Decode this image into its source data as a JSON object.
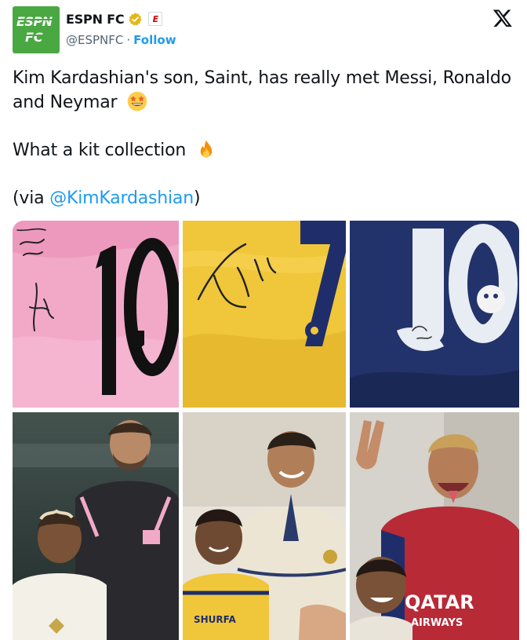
{
  "account": {
    "display_name": "ESPN FC",
    "handle": "@ESPNFC",
    "separator": "·",
    "follow_label": "Follow",
    "avatar_text_line1": "ESPN",
    "avatar_text_line2": "FC",
    "affiliate_badge": "E",
    "brand_color": "#4aa843",
    "verified_color": "#e2b719"
  },
  "tweet": {
    "line1": "Kim Kardashian's son, Saint, has really met Messi, Ronaldo and Neymar",
    "emoji1": "star-struck-emoji",
    "line2": "What a kit collection",
    "emoji2": "fire-emoji",
    "via_prefix": "(via ",
    "via_mention": "@KimKardashian",
    "via_suffix": ")"
  },
  "media": {
    "tiles": [
      {
        "name": "messi-signed-jersey",
        "text": "10",
        "color": "#f2a9c8"
      },
      {
        "name": "ronaldo-signed-jersey",
        "text": "7",
        "color": "#f0c63a"
      },
      {
        "name": "neymar-signed-jersey",
        "text": "10",
        "color": "#22336b"
      },
      {
        "name": "saint-with-messi-photo",
        "color": "#2b3b3a"
      },
      {
        "name": "saint-with-ronaldo-photo",
        "sponsor": "SHURFA",
        "color": "#e8e4da"
      },
      {
        "name": "saint-with-neymar-photo",
        "sponsor": "QATAR",
        "sponsor2": "AIRWAYS",
        "color": "#b72a36"
      }
    ]
  },
  "colors": {
    "link": "#1d9bf0",
    "text": "#0f1419",
    "secondary": "#536471"
  }
}
